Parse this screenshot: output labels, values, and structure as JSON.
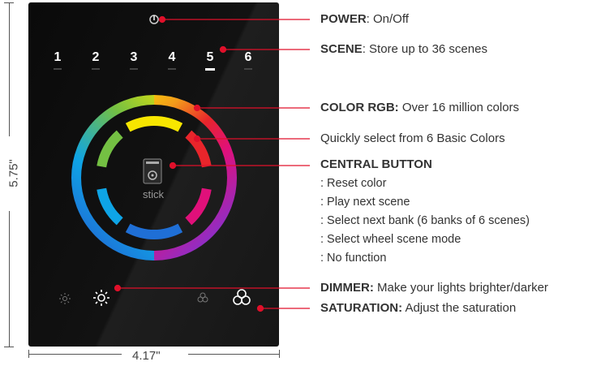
{
  "dimensions": {
    "height_label": "5.75\"",
    "width_label": "4.17\""
  },
  "panel": {
    "scene_numbers": [
      "1",
      "2",
      "3",
      "4",
      "5",
      "6"
    ],
    "active_scene": "5",
    "logo_text": "stick"
  },
  "callouts": {
    "power": {
      "title": "POWER",
      "text": ": On/Off"
    },
    "scene": {
      "title": "SCENE",
      "text": ": Store up to 36 scenes"
    },
    "color_rgb": {
      "title": "COLOR RGB:",
      "text": " Over 16 million colors"
    },
    "basic_colors": {
      "text": "Quickly select from 6 Basic Colors"
    },
    "central_button": {
      "title": "CENTRAL BUTTON",
      "items": [
        ": Reset color",
        ": Play next scene",
        ": Select next bank (6 banks of 6 scenes)",
        ": Select wheel scene mode",
        ": No function"
      ]
    },
    "dimmer": {
      "title": "DIMMER:",
      "text": " Make your lights brighter/darker"
    },
    "saturation": {
      "title": "SATURATION:",
      "text": " Adjust the saturation"
    }
  },
  "colors": {
    "callout_line": "#e0102a",
    "panel": "#0d0d0d",
    "basic_colors": [
      "#f7e600",
      "#e8252b",
      "#e0107a",
      "#1f6fd6",
      "#0ea4e6",
      "#74c043"
    ]
  }
}
